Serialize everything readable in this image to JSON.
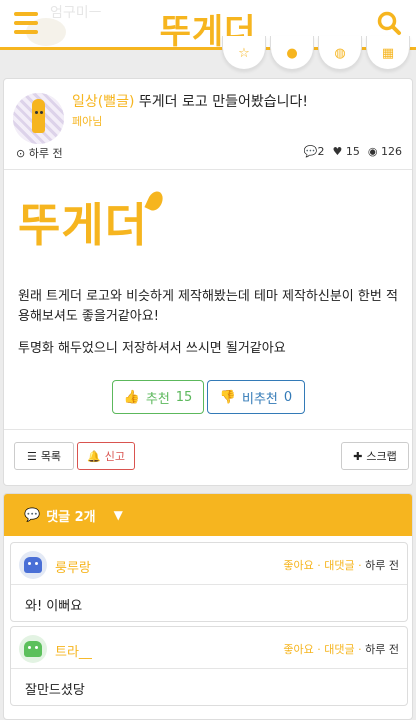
{
  "header": {
    "logo": "뚜게더",
    "ghost_text": "엄구미ㅡ"
  },
  "post": {
    "category": "일상(뻘글)",
    "title": "뚜게더 로고 만들어봤습니다!",
    "author": "페아님",
    "time": "하루 전",
    "comments_count": "2",
    "likes_count": "15",
    "views_count": "126",
    "image_logo_text": "뚜게더",
    "paragraph1": "원래 트게더 로고와 비슷하게 제작해봤는데 테마 제작하신분이 한번 적용해보셔도 좋을거같아요!",
    "paragraph2": "투명화 해두었으니 저장하셔서 쓰시면 될거같아요",
    "vote_up_label": "추천",
    "vote_up_count": "15",
    "vote_down_label": "비추천",
    "vote_down_count": "0",
    "list_label": "목록",
    "report_label": "신고",
    "scrap_label": "스크랩"
  },
  "comments_section": {
    "header_label": "댓글 2개",
    "comments": [
      {
        "name": "룽루랑",
        "like_label": "좋아요",
        "reply_label": "대댓글",
        "time": "하루 전",
        "body": "와! 이뻐요"
      },
      {
        "name": "트라__",
        "like_label": "좋아요",
        "reply_label": "대댓글",
        "time": "하루 전",
        "body": "잘만드셨당"
      }
    ]
  },
  "colors": {
    "accent": "#f6b51f",
    "up": "#5cb85c",
    "down": "#337ab7",
    "report": "#d9534f"
  },
  "icons": [
    "menu-icon",
    "search-icon",
    "star-icon",
    "info-icon",
    "chat-icon",
    "save-icon",
    "clock-icon",
    "comment-icon",
    "heart-icon",
    "eye-icon",
    "thumbs-up-icon",
    "thumbs-down-icon",
    "list-icon",
    "bell-icon",
    "plus-icon",
    "caret-down-icon"
  ]
}
